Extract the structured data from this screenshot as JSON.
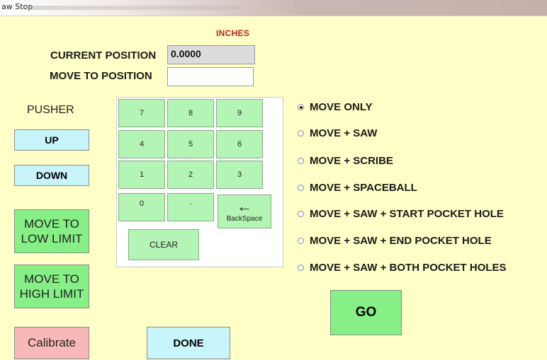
{
  "window": {
    "title": "aw Stop"
  },
  "units_label": "INCHES",
  "current_position": {
    "label": "CURRENT POSITION",
    "value": "0.0000"
  },
  "move_to_position": {
    "label": "MOVE TO POSITION",
    "value": ""
  },
  "pusher": {
    "label": "PUSHER",
    "up": "UP",
    "down": "DOWN",
    "move_low": [
      "MOVE TO",
      "LOW LIMIT"
    ],
    "move_high": [
      "MOVE TO",
      "HIGH LIMIT"
    ]
  },
  "keypad": {
    "keys": [
      "7",
      "8",
      "9",
      "4",
      "5",
      "6",
      "1",
      "2",
      "3",
      "0",
      "."
    ],
    "backspace_label": "BackSpace",
    "clear_label": "CLEAR"
  },
  "options": [
    {
      "label": "MOVE ONLY",
      "selected": true
    },
    {
      "label": "MOVE + SAW",
      "selected": false
    },
    {
      "label": "MOVE + SCRIBE",
      "selected": false
    },
    {
      "label": "MOVE + SPACEBALL",
      "selected": false
    },
    {
      "label": "MOVE + SAW + START POCKET HOLE",
      "selected": false
    },
    {
      "label": "MOVE + SAW + END POCKET HOLE",
      "selected": false
    },
    {
      "label": "MOVE + SAW + BOTH POCKET HOLES",
      "selected": false
    }
  ],
  "go_label": "GO",
  "calibrate_label": "Calibrate",
  "done_label": "DONE",
  "colors": {
    "background": "#ffffc8",
    "blue_button": "#c8f4fc",
    "green_button": "#86ef86",
    "pink_button": "#f9b8b8",
    "keypad_key": "#b4f4b4",
    "units_text": "#c0221a"
  }
}
